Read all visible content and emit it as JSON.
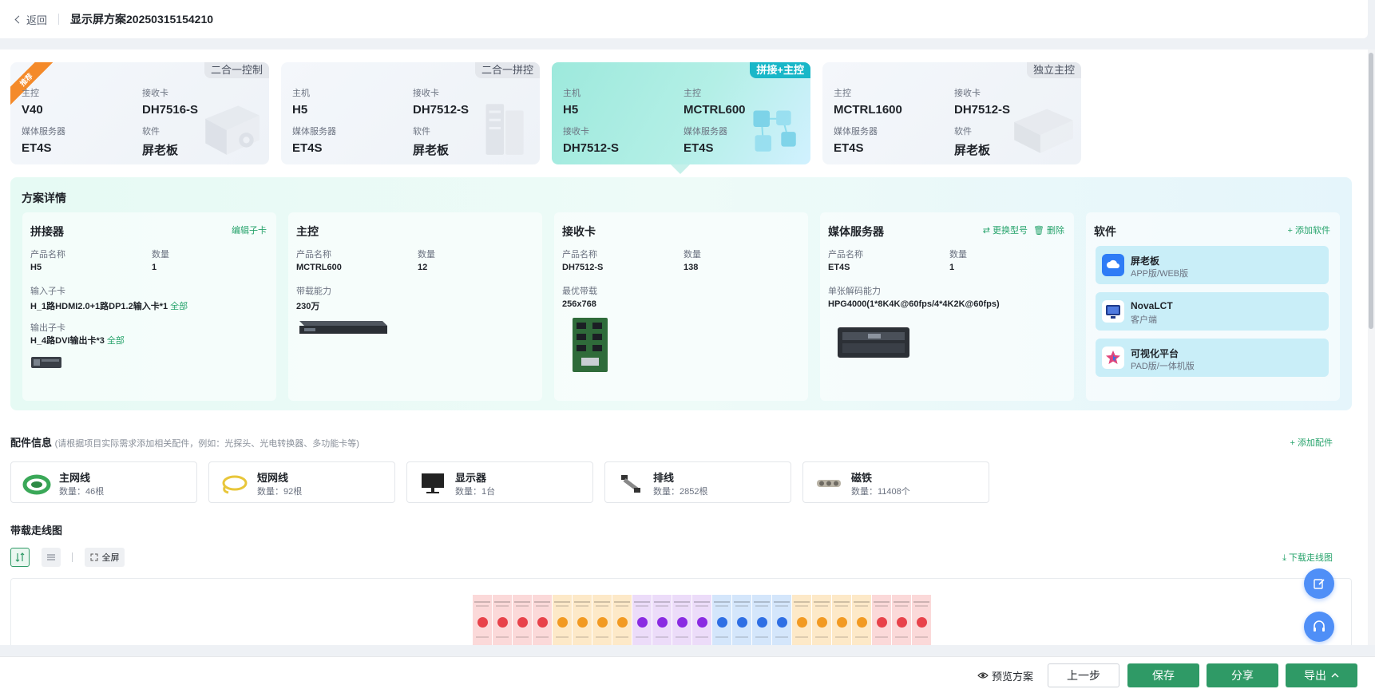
{
  "header": {
    "back_label": "返回",
    "title": "显示屏方案20250315154210"
  },
  "schemes": [
    {
      "tag": "二合一控制",
      "badge": "推荐",
      "illustration": "server-gear-icon",
      "fields": [
        {
          "label": "主控",
          "value": "V40"
        },
        {
          "label": "接收卡",
          "value": "DH7516-S"
        },
        {
          "label": "媒体服务器",
          "value": "ET4S"
        },
        {
          "label": "软件",
          "value": "屏老板"
        }
      ]
    },
    {
      "tag": "二合一拼控",
      "illustration": "server-rack-icon",
      "fields": [
        {
          "label": "主机",
          "value": "H5"
        },
        {
          "label": "接收卡",
          "value": "DH7512-S"
        },
        {
          "label": "媒体服务器",
          "value": "ET4S"
        },
        {
          "label": "软件",
          "value": "屏老板"
        }
      ]
    },
    {
      "tag": "拼接+主控",
      "illustration": "network-cubes-icon",
      "fields": [
        {
          "label": "主机",
          "value": "H5"
        },
        {
          "label": "主控",
          "value": "MCTRL600"
        },
        {
          "label": "接收卡",
          "value": "DH7512-S"
        },
        {
          "label": "媒体服务器",
          "value": "ET4S"
        }
      ]
    },
    {
      "tag": "独立主控",
      "illustration": "server-box-icon",
      "fields": [
        {
          "label": "主控",
          "value": "MCTRL1600"
        },
        {
          "label": "接收卡",
          "value": "DH7512-S"
        },
        {
          "label": "媒体服务器",
          "value": "ET4S"
        },
        {
          "label": "软件",
          "value": "屏老板"
        }
      ]
    }
  ],
  "detail": {
    "title": "方案详情",
    "splicer": {
      "title": "拼接器",
      "action": "编辑子卡",
      "name_label": "产品名称",
      "name": "H5",
      "qty_label": "数量",
      "qty": "1",
      "input_label": "输入子卡",
      "input_value": "H_1路HDMI2.0+1路DP1.2输入卡*1",
      "input_link": "全部",
      "output_label": "输出子卡",
      "output_value": "H_4路DVI输出卡*3",
      "output_link": "全部"
    },
    "controller": {
      "title": "主控",
      "name_label": "产品名称",
      "name": "MCTRL600",
      "qty_label": "数量",
      "qty": "12",
      "cap_label": "带载能力",
      "cap": "230万"
    },
    "receiver": {
      "title": "接收卡",
      "name_label": "产品名称",
      "name": "DH7512-S",
      "qty_label": "数量",
      "qty": "138",
      "cap_label": "最优带载",
      "cap": "256x768"
    },
    "media": {
      "title": "媒体服务器",
      "action_replace": "更换型号",
      "action_delete": "删除",
      "name_label": "产品名称",
      "name": "ET4S",
      "qty_label": "数量",
      "qty": "1",
      "cap_label": "单张解码能力",
      "cap": "HPG4000(1*8K4K@60fps/4*4K2K@60fps)"
    },
    "software": {
      "title": "软件",
      "action": "添加软件",
      "items": [
        {
          "name": "屏老板",
          "sub": "APP版/WEB版",
          "icon": "cloud-app-icon",
          "color": "#2e7cf6"
        },
        {
          "name": "NovaLCT",
          "sub": "客户端",
          "icon": "monitor-app-icon",
          "color": "#1e3a8a"
        },
        {
          "name": "可视化平台",
          "sub": "PAD版/一体机版",
          "icon": "star-app-icon",
          "color": "#e0457b"
        }
      ]
    }
  },
  "accessories": {
    "title": "配件信息",
    "note": "(请根据项目实际需求添加相关配件，例如：光探头、光电转换器、多功能卡等)",
    "add_label": "添加配件",
    "items": [
      {
        "name": "主网线",
        "count": "数量：46根",
        "icon": "green-cable-icon",
        "color": "#3aa858"
      },
      {
        "name": "短网线",
        "count": "数量：92根",
        "icon": "yellow-cable-icon",
        "color": "#e8c63a"
      },
      {
        "name": "显示器",
        "count": "数量：1台",
        "icon": "monitor-icon",
        "color": "#222222"
      },
      {
        "name": "排线",
        "count": "数量：2852根",
        "icon": "ribbon-cable-icon",
        "color": "#555555"
      },
      {
        "name": "磁铁",
        "count": "数量：11408个",
        "icon": "magnet-icon",
        "color": "#b9b3a6"
      }
    ]
  },
  "wiring": {
    "title": "带载走线图",
    "fullscreen_label": "全屏",
    "download_label": "下载走线图",
    "columns": [
      {
        "bg": "#fbd9d9",
        "dot": "#e8424a"
      },
      {
        "bg": "#fbd9d9",
        "dot": "#e8424a"
      },
      {
        "bg": "#fbd9d9",
        "dot": "#e8424a"
      },
      {
        "bg": "#fbd9d9",
        "dot": "#e8424a"
      },
      {
        "bg": "#fde9c8",
        "dot": "#f29a22"
      },
      {
        "bg": "#fde9c8",
        "dot": "#f29a22"
      },
      {
        "bg": "#fde9c8",
        "dot": "#f29a22"
      },
      {
        "bg": "#fde9c8",
        "dot": "#f29a22"
      },
      {
        "bg": "#ecdcf9",
        "dot": "#8a2be2"
      },
      {
        "bg": "#ecdcf9",
        "dot": "#8a2be2"
      },
      {
        "bg": "#ecdcf9",
        "dot": "#8a2be2"
      },
      {
        "bg": "#ecdcf9",
        "dot": "#8a2be2"
      },
      {
        "bg": "#d4e6fb",
        "dot": "#2f6fe4"
      },
      {
        "bg": "#d4e6fb",
        "dot": "#2f6fe4"
      },
      {
        "bg": "#d4e6fb",
        "dot": "#2f6fe4"
      },
      {
        "bg": "#d4e6fb",
        "dot": "#2f6fe4"
      },
      {
        "bg": "#fde9c8",
        "dot": "#f29a22"
      },
      {
        "bg": "#fde9c8",
        "dot": "#f29a22"
      },
      {
        "bg": "#fde9c8",
        "dot": "#f29a22"
      },
      {
        "bg": "#fde9c8",
        "dot": "#f29a22"
      },
      {
        "bg": "#fbd9d9",
        "dot": "#e8424a"
      },
      {
        "bg": "#fbd9d9",
        "dot": "#e8424a"
      },
      {
        "bg": "#fbd9d9",
        "dot": "#e8424a"
      }
    ]
  },
  "footer": {
    "preview": "预览方案",
    "prev": "上一步",
    "save": "保存",
    "share": "分享",
    "export": "导出"
  },
  "colors": {
    "primary": "#2f9a66",
    "accent_green": "#26a36b",
    "fab_blue": "#4f8ff7",
    "active_tag": "#19b7c8"
  }
}
